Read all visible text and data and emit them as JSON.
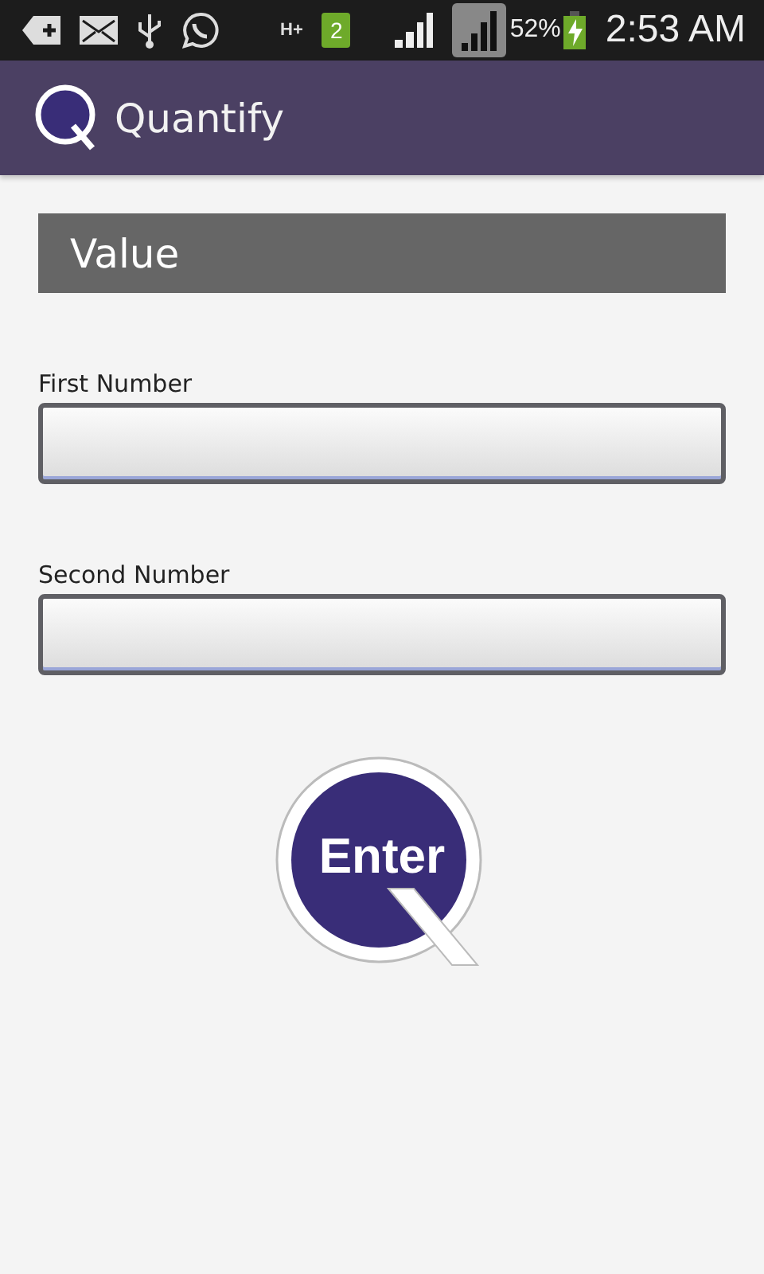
{
  "status_bar": {
    "network_type": "H+",
    "sim_slot": "2",
    "battery": "52%",
    "time": "2:53 AM"
  },
  "app_bar": {
    "title": "Quantify"
  },
  "section": {
    "title": "Value"
  },
  "fields": [
    {
      "label": "First Number"
    },
    {
      "label": "Second Number"
    }
  ],
  "enter_button": {
    "label": "Enter"
  }
}
